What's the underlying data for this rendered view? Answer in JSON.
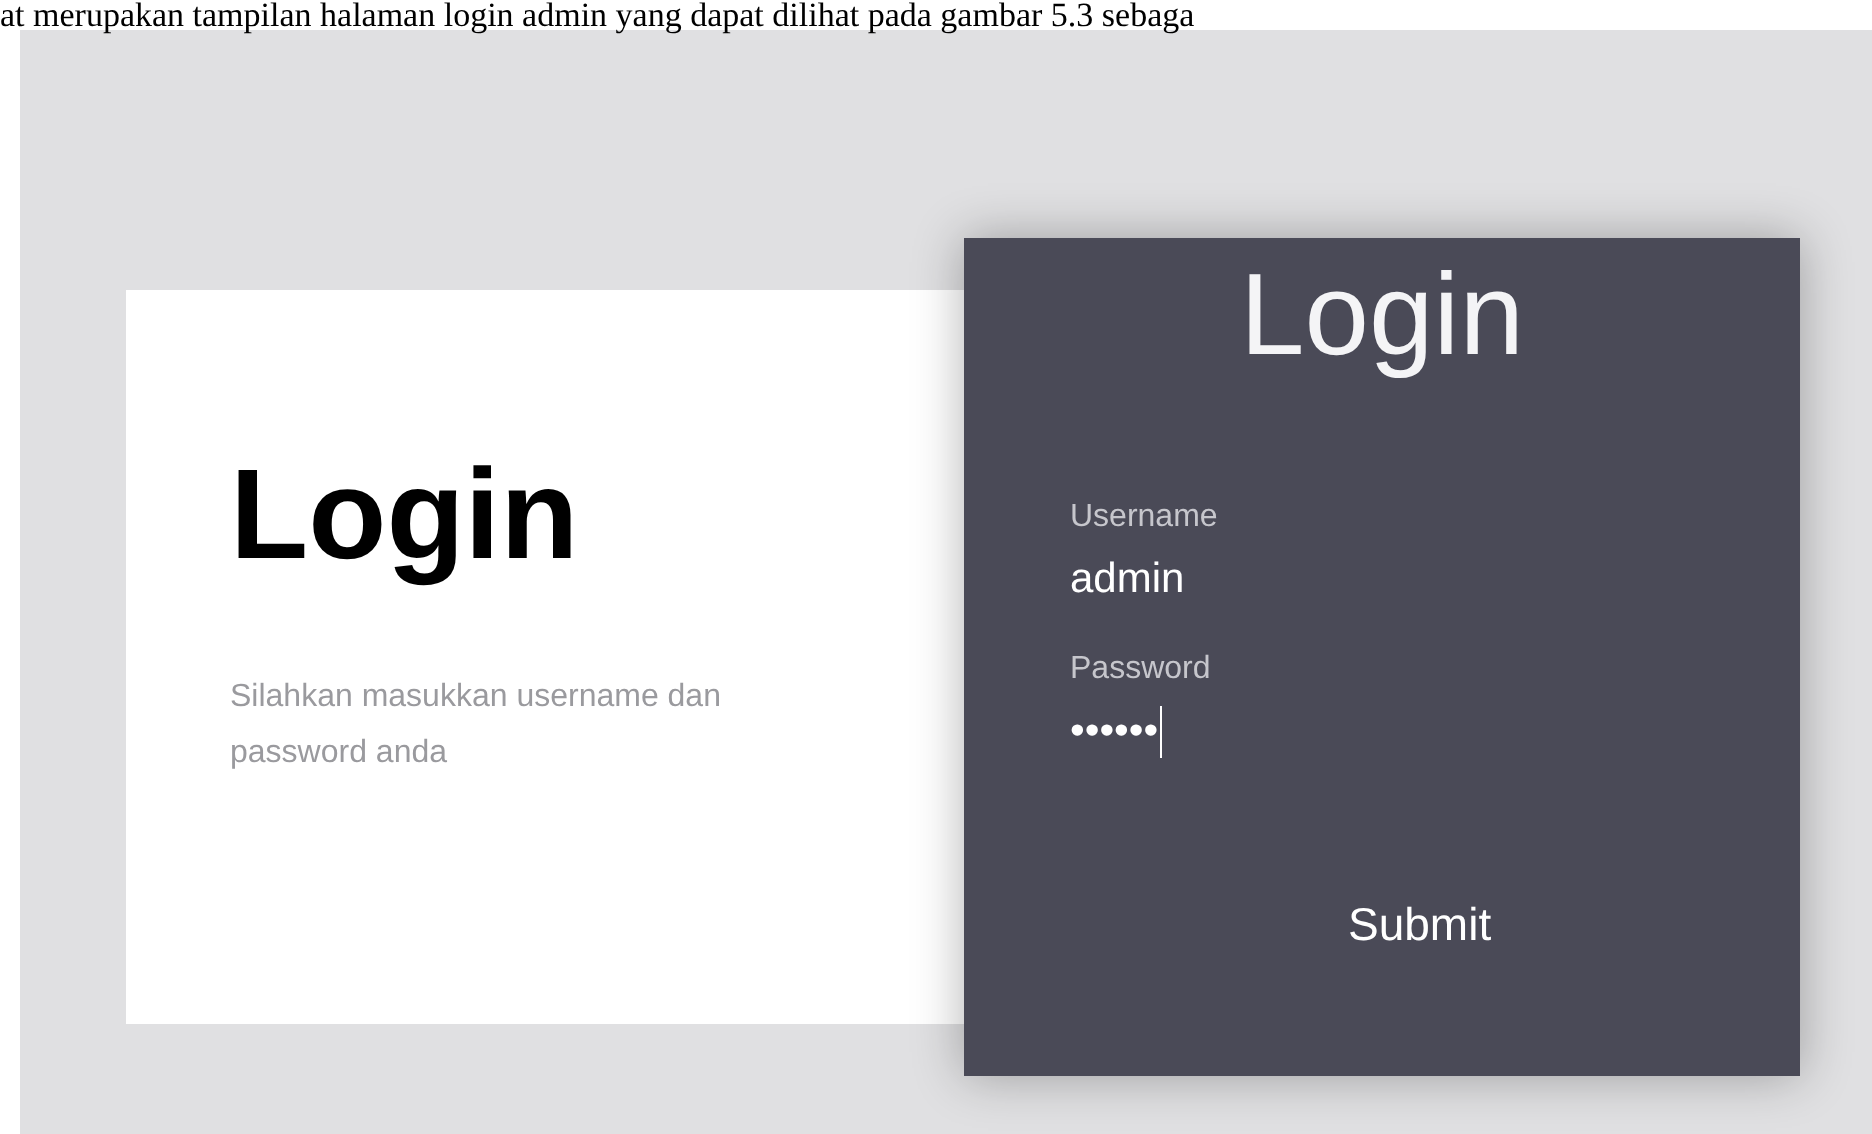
{
  "document_text": "at merupakan tampilan halaman login admin yang dapat dilihat pada gambar 5.3 sebaga",
  "intro": {
    "title": "Login",
    "description": "Silahkan masukkan username dan password anda"
  },
  "form": {
    "title": "Login",
    "fields": [
      {
        "label": "Username",
        "value": "admin",
        "focused": false
      },
      {
        "label": "Password",
        "value": "••••••",
        "focused": true
      }
    ],
    "button": "Submit"
  }
}
